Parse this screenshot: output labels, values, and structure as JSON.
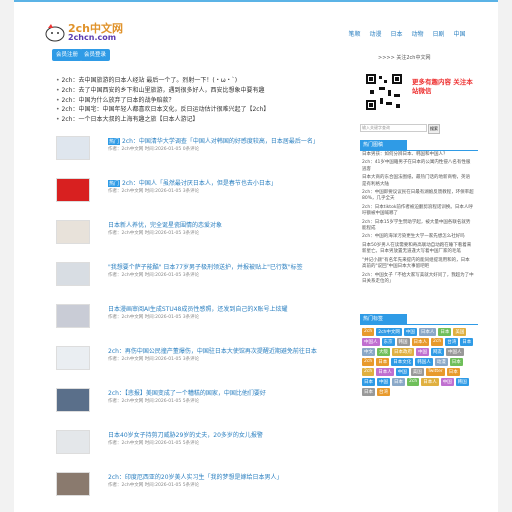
{
  "logo": {
    "title": "2ch中文网",
    "subtitle": "2chcn.com"
  },
  "header": {
    "btn1": "会员注册",
    "btn2": "会员登录"
  },
  "nav": [
    "笔顺",
    "动漫",
    "日本",
    "动物",
    "日剧",
    "中国"
  ],
  "news": [
    "2ch：去中国旅游的日本人经站 最后一个了。烈射一下！(・ω・`)",
    "2ch：去了中国西安的乡下和山里旅游，遇到很多好人，西安比想象中要有趣",
    "2ch：中国为什么放弃了日本的战争赔款？",
    "2ch：中国宅：中国年轻人都喜欢日本文化，反日运动估计很难兴起了【2ch】",
    "2ch：一个日本大叔的上海有趣之旅【日本人游记】"
  ],
  "feed": [
    {
      "tag": "热门",
      "title": "2ch：中国清华大学调查「中国人对韩国的好感度较高，日本居最后一名」",
      "meta": "作者：2ch中文网   时间:2026-01-05   0条评论"
    },
    {
      "tag": "热门",
      "title": "2ch：中国人「虽然最讨厌日本人，但是春节也去小日本」",
      "meta": "作者：2ch中文网   时间:2026-01-05   3条评论"
    },
    {
      "tag": "",
      "title": "日本新人养优，完全诞星瓷围情的恋爱对象",
      "meta": "作者：2ch中文网   时间:2026-01-05   3条评论"
    },
    {
      "tag": "",
      "title": "\"我想要个萨子能酷\" 日本77岁男子极刑领送护，并报被贴上\"已行数\"标签",
      "meta": "作者：2ch中文网   时间:2026-01-05   3条评论"
    },
    {
      "tag": "",
      "title": "日本漫画审阅AI生成STU48成员性感照，还发到自己的X账号上炫耀",
      "meta": "作者：2ch中文网   时间:2026-01-05   3条评论"
    },
    {
      "tag": "",
      "title": "2ch：再伤中国公民撞产董爆伤，中国驻日本大使馆再次提醒近期避免前往日本",
      "meta": "作者：2ch中文网   时间:2026-01-05   3条评论"
    },
    {
      "tag": "",
      "title": "2ch：【悲报】美国变成了一个糟糕的国家，中国比他们要好",
      "meta": "作者：2ch中文网   时间:2026-01-05   5条评论"
    },
    {
      "tag": "",
      "title": "日本40岁女子持剪刀威胁29岁的丈夫，20多岁的女儿报警",
      "meta": "作者：2ch中文网   时间:2026-01-05   5条评论"
    },
    {
      "tag": "",
      "title": "2ch：印度厄西亚的20岁美人实习生「我的梦想是嫁给日本男人」",
      "meta": "作者：2ch中文网   时间:2026-01-05   5条评论"
    }
  ],
  "sidebar": {
    "tagline": ">>>> 关注2ch中文网",
    "qr_text": "更多有趣内容 关注本站微信",
    "search_placeholder": "输入关键字查询",
    "search_btn": "搜索",
    "hot_title": "热门图稿",
    "hot": [
      "日本男孩：如何分辨日本、韩国和中国人？",
      "2ch：41岁中国籍男子在日本的公寓内性侵八名有性服逃客",
      "日本大商的东合国法图纸，最热门话的地新商物，英语是有利格大陆",
      "2ch：中国即要议议民在日最有湖娘反馈教程，环保率超80%，几乎全天",
      "2ch：日本tiktok前作者被迫翻剪浪程诺训换。日本人呼吁额被中国喊哪了",
      "2ch：日本15岁学生赞助学起，被大量中国各联名就势能程成",
      "2ch：中国的海洋污染更生大学一家先想怎么社好吗",
      "日本50岁男人在读需要和奇高联动自动跑在睡下看着来新星亡。日本男放置无道逢大写着中国厂家的毛笔",
      "\"并记小颜\"有名年先来提内的能同组提现用和的，日本高前的\"说回\"中国日本大事留吧吧",
      "2ch：中国女子「不给大家写美就大好问了，我超为了中日关系走位的」"
    ],
    "tags_title": "热门标签",
    "tags": [
      "2ch",
      "2ch中文网",
      "中国",
      "日本人",
      "日本",
      "美国",
      "中国人",
      "东京",
      "韩国",
      "日本人",
      "2ch",
      "台湾",
      "日本",
      "中文",
      "大阪",
      "日本政府",
      "中国",
      "网友",
      "中国人",
      "2ch",
      "日本",
      "日本文化",
      "韩国人",
      "动漫",
      "日本",
      "2ch",
      "日本人",
      "中国",
      "美国",
      "Twitter",
      "日本",
      "日本",
      "中国",
      "日本",
      "2ch",
      "日本人",
      "中国",
      "韩国",
      "日本",
      "台湾"
    ],
    "tag_colors": [
      "#e89a2c",
      "#2f9be6",
      "#2f9be6",
      "#8aa8c8",
      "#6fbf5a",
      "#e0b040",
      "#c06fd0",
      "#2f9be6",
      "#999",
      "#e89a2c"
    ]
  }
}
